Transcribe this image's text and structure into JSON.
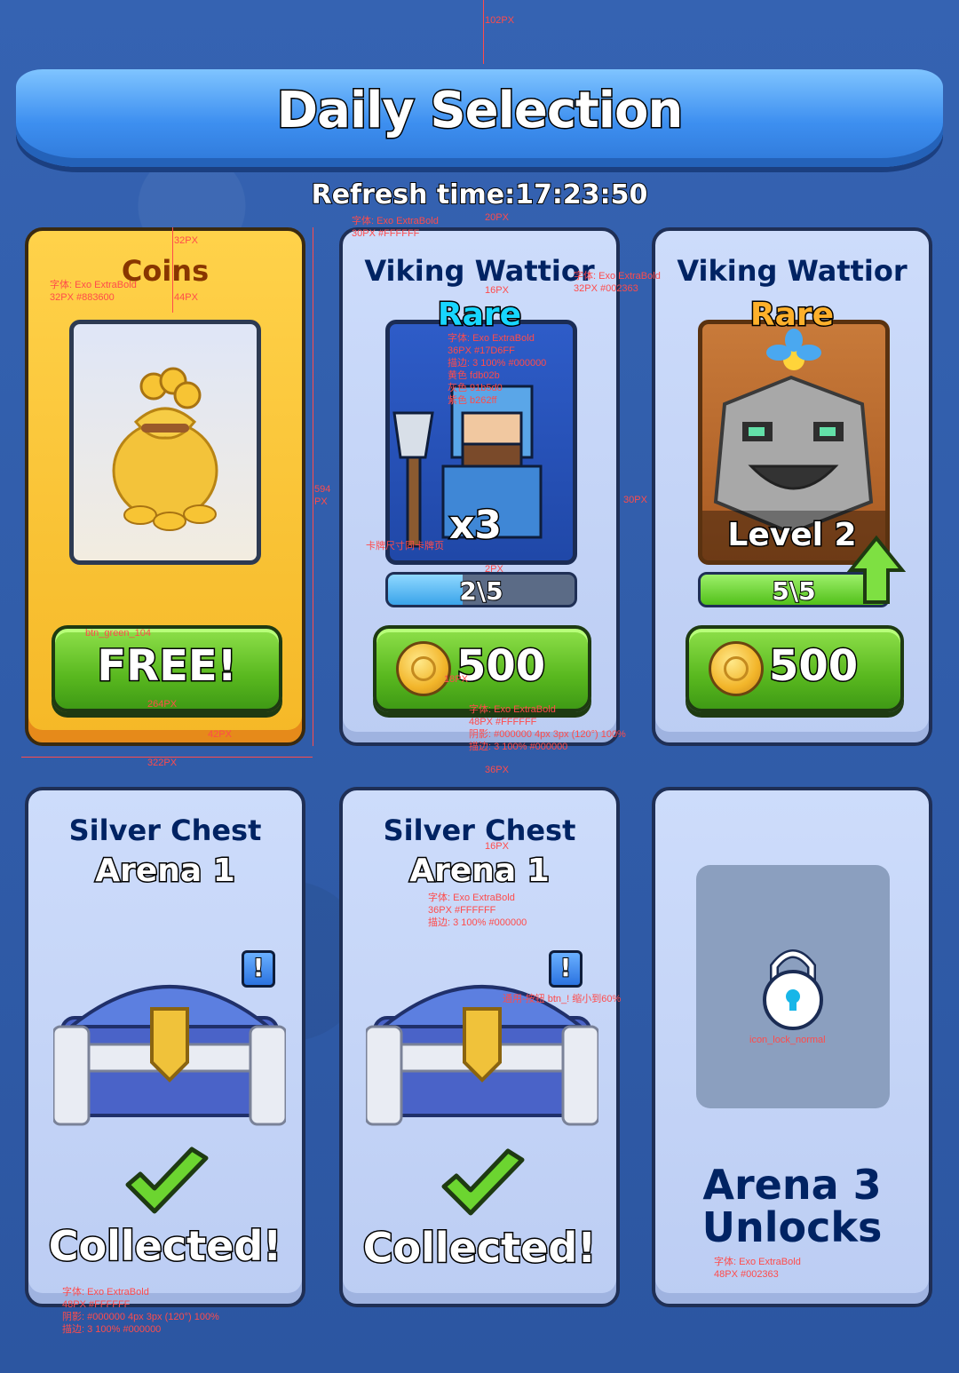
{
  "header": {
    "title": "Daily Selection",
    "refresh": "Refresh time:17:23:50"
  },
  "shop": [
    {
      "title": "Coins",
      "button": "FREE!"
    },
    {
      "title": "Viking Wattior",
      "rarity": "Rare",
      "count": "x3",
      "progress_text": "2\\5",
      "progress": 0.4,
      "price": "500"
    },
    {
      "title": "Viking Wattior",
      "rarity": "Rare",
      "level": "Level 2",
      "progress_text": "5\\5",
      "progress": 1.0,
      "price": "500"
    }
  ],
  "chests": [
    {
      "title": "Silver Chest",
      "arena": "Arena 1",
      "badge": "!",
      "status": "Collected!"
    },
    {
      "title": "Silver Chest",
      "arena": "Arena 1",
      "badge": "!",
      "status": "Collected!"
    },
    {
      "title": "Arena 3\nUnlocks",
      "lock_icon": "lock-icon"
    }
  ],
  "annotations": {
    "a102": "102PX",
    "a_refresh": "字体: Exo ExtraBold\n30PX #FFFFFF",
    "a20": "20PX",
    "a32": "32PX",
    "a_coins": "字体: Exo ExtraBold\n32PX #883600",
    "a44": "44PX",
    "a594": "594\nPX",
    "a_vtitle": "字体: Exo ExtraBold\n32PX #002363",
    "a16": "16PX",
    "a_rare": "字体: Exo ExtraBold\n36PX #17D6FF\n描边: 3 100% #000000\n黄色 fdb02b\n灰色 91b5d0\n紫色 b262ff",
    "a30": "30PX",
    "a_card": "卡牌尺寸同卡牌页",
    "a2": "2PX",
    "a_btngreen": "btn_green_104",
    "a264": "264PX",
    "a18": "18PX",
    "a42": "42PX",
    "a322": "322PX",
    "a_price": "字体: Exo ExtraBold\n48PX #FFFFFF\n阴影: #000000 4px 3px (120°) 100%\n描边: 3 100% #000000",
    "a36": "36PX",
    "a16b": "16PX",
    "a_arena": "字体: Exo ExtraBold\n36PX #FFFFFF\n描边: 3 100% #000000",
    "a_btnexcl": "通用-按钮 btn_! 缩小到60%",
    "a_lock": "icon_lock_normal",
    "a_collected": "字体: Exo ExtraBold\n48PX #FFFFFF\n阴影: #000000 4px 3px (120°) 100%\n描边: 3 100% #000000",
    "a_arena3": "字体: Exo ExtraBold\n48PX #002363"
  }
}
